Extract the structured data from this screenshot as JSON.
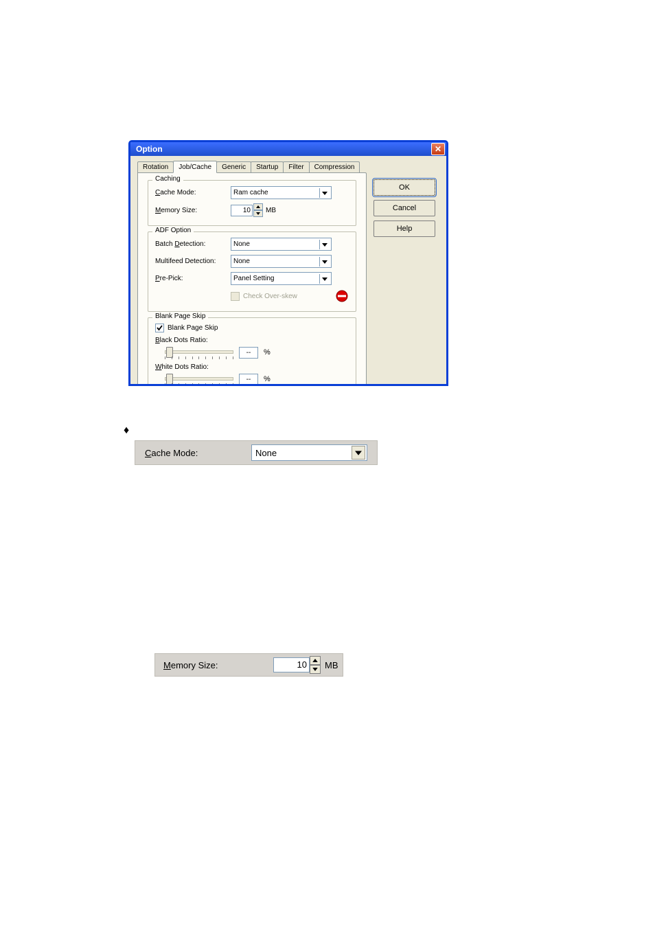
{
  "dialog": {
    "title": "Option",
    "tabs": [
      "Rotation",
      "Job/Cache",
      "Generic",
      "Startup",
      "Filter",
      "Compression"
    ],
    "active_tab_index": 1,
    "buttons": {
      "ok": "OK",
      "cancel": "Cancel",
      "help": "Help"
    },
    "caching": {
      "group_title": "Caching",
      "cache_mode_label": "Cache Mode:",
      "cache_mode_value": "Ram cache",
      "memory_size_label": "Memory Size:",
      "memory_size_value": "10",
      "memory_size_unit": "MB"
    },
    "adf": {
      "group_title": "ADF Option",
      "batch_detection_label": "Batch Detection:",
      "batch_detection_value": "None",
      "multifeed_label": "Multifeed Detection:",
      "multifeed_value": "None",
      "prepick_label": "Pre-Pick:",
      "prepick_value": "Panel Setting",
      "check_overskew_label": "Check Over-skew"
    },
    "blankpage": {
      "group_title": "Blank Page Skip",
      "checkbox_label": "Blank Page Skip",
      "checked": true,
      "black_label": "Black Dots Ratio:",
      "black_value": "--",
      "black_unit": "%",
      "white_label": "White Dots Ratio:",
      "white_value": "--",
      "white_unit": "%"
    }
  },
  "clip_cache_mode": {
    "label": "Cache Mode:",
    "value": "None"
  },
  "clip_memory_size": {
    "label": "Memory Size:",
    "value": "10",
    "unit": "MB"
  }
}
